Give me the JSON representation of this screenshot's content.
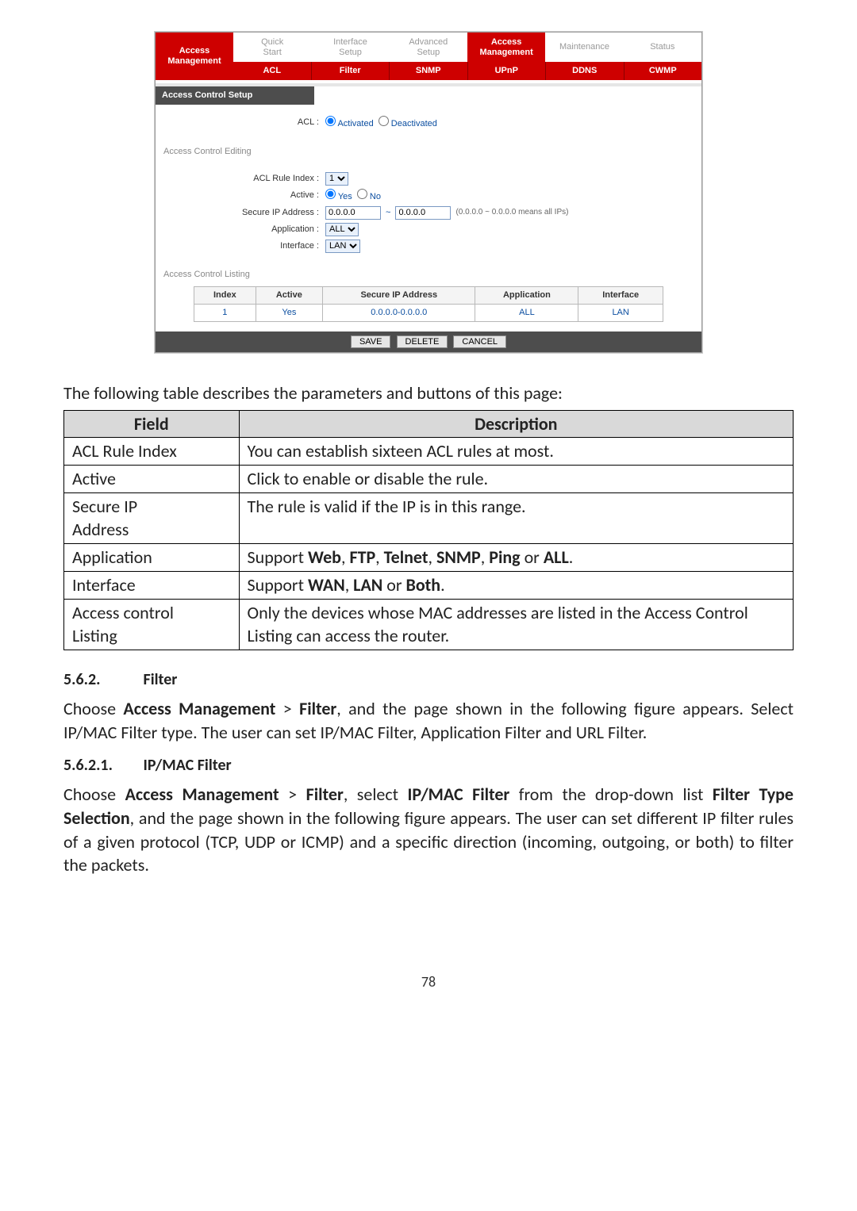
{
  "screenshot": {
    "leftHeader": {
      "line1": "Access",
      "line2": "Management"
    },
    "tabs1": [
      "Quick Start",
      "Interface Setup",
      "Advanced Setup",
      "Access Management",
      "Maintenance",
      "Status"
    ],
    "tabs1_activeIndex": 3,
    "tabs2": [
      "ACL",
      "Filter",
      "SNMP",
      "UPnP",
      "DDNS",
      "CWMP"
    ],
    "tabs2_activeIndex": 0,
    "section_setup": "Access Control Setup",
    "acl_label": "ACL :",
    "acl_activated": "Activated",
    "acl_deactivated": "Deactivated",
    "section_editing": "Access Control Editing",
    "rule_index_label": "ACL Rule Index :",
    "rule_index_value": "1",
    "active_label": "Active :",
    "active_yes": "Yes",
    "active_no": "No",
    "secure_ip_label": "Secure IP Address :",
    "secure_ip_from": "0.0.0.0",
    "secure_ip_sep": "~",
    "secure_ip_to": "0.0.0.0",
    "secure_ip_hint": "(0.0.0.0 ~ 0.0.0.0 means all IPs)",
    "application_label": "Application :",
    "application_value": "ALL",
    "interface_label": "Interface :",
    "interface_value": "LAN",
    "section_listing": "Access Control Listing",
    "acl_table": {
      "headers": [
        "Index",
        "Active",
        "Secure IP Address",
        "Application",
        "Interface"
      ],
      "rows": [
        [
          "1",
          "Yes",
          "0.0.0.0-0.0.0.0",
          "ALL",
          "LAN"
        ]
      ]
    },
    "buttons": {
      "save": "SAVE",
      "delete": "DELETE",
      "cancel": "CANCEL"
    }
  },
  "doc": {
    "intro": "The following table describes the parameters and buttons of this page:",
    "table": {
      "headers": [
        "Field",
        "Description"
      ],
      "rows": [
        {
          "field": "ACL Rule Index",
          "desc": "You can establish sixteen ACL rules at most."
        },
        {
          "field": "Active",
          "desc": "Click to enable or disable the rule."
        },
        {
          "field": "Secure IP Address",
          "desc": "The rule is valid if the IP is in this range."
        },
        {
          "field": "Application",
          "desc_html": "Support <b>Web</b>, <b>FTP</b>, <b>Telnet</b>, <b>SNMP</b>, <b>Ping</b> or <b>ALL</b>."
        },
        {
          "field": "Interface",
          "desc_html": "Support <b>WAN</b>, <b>LAN</b> or <b>Both</b>."
        },
        {
          "field": "Access control Listing",
          "desc": "Only the devices whose MAC addresses are listed in the Access Control Listing can access the router."
        }
      ]
    },
    "sec562_num": "5.6.2.",
    "sec562_title": "Filter",
    "para562_html": "Choose <b>Access Management</b> > <b>Filter</b>, and the page shown in the following figure appears. Select IP/MAC Filter type. The user can set IP/MAC Filter, Application Filter and URL Filter.",
    "sec5621_num": "5.6.2.1.",
    "sec5621_title": "IP/MAC Filter",
    "para5621_html": "Choose <b>Access Management</b> > <b>Filter</b>, select <b>IP/MAC Filter</b> from the drop-down list <b>Filter Type Selection</b>, and the page shown in the following figure appears. The user can set different IP filter rules of a given protocol (TCP, UDP or ICMP) and a specific direction (incoming, outgoing, or both) to filter the packets.",
    "page": "78"
  }
}
